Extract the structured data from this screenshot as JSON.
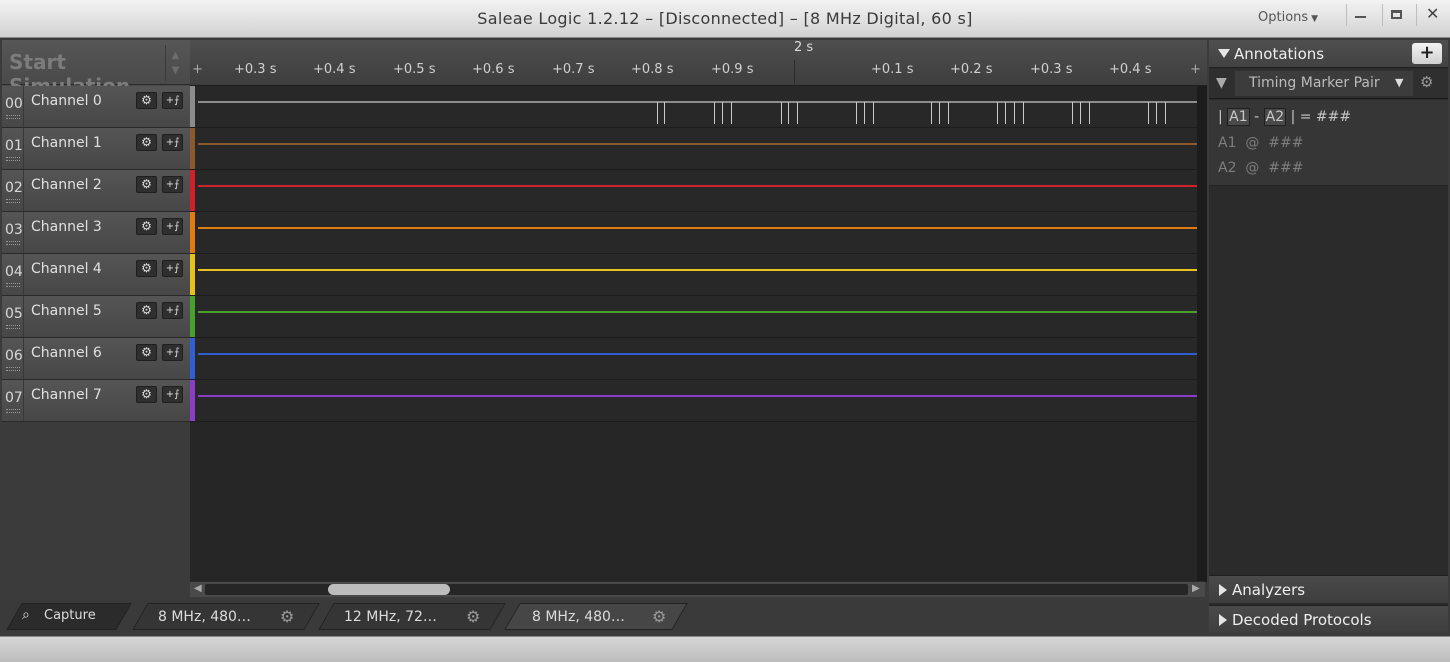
{
  "window": {
    "title": "Saleae Logic 1.2.12 – [Disconnected] – [8 MHz Digital, 60 s]",
    "options_label": "Options"
  },
  "simulation": {
    "label": "Start Simulation"
  },
  "channels": [
    {
      "num": "00",
      "name": "Channel 0",
      "color": "#8c8c8c"
    },
    {
      "num": "01",
      "name": "Channel 1",
      "color": "#8b5a2b"
    },
    {
      "num": "02",
      "name": "Channel 2",
      "color": "#d0202a"
    },
    {
      "num": "03",
      "name": "Channel 3",
      "color": "#e07b10"
    },
    {
      "num": "04",
      "name": "Channel 4",
      "color": "#e6c21a"
    },
    {
      "num": "05",
      "name": "Channel 5",
      "color": "#4aa02c"
    },
    {
      "num": "06",
      "name": "Channel 6",
      "color": "#2f5fd0"
    },
    {
      "num": "07",
      "name": "Channel 7",
      "color": "#8a3ec8"
    }
  ],
  "timeline": {
    "center_label": "2 s",
    "ticks": [
      "+0.3 s",
      "+0.4 s",
      "+0.5 s",
      "+0.6 s",
      "+0.7 s",
      "+0.8 s",
      "+0.9 s",
      "+0.1 s",
      "+0.2 s",
      "+0.3 s",
      "+0.4 s"
    ],
    "edge_left": "+",
    "edge_right": "+"
  },
  "tabs": {
    "capture_label": "Capture",
    "sessions": [
      "8 MHz, 480…",
      "12 MHz, 72…",
      "8 MHz, 480…"
    ]
  },
  "annotations": {
    "title": "Annotations",
    "add_label": "+",
    "marker_pair_label": "Timing Marker Pair",
    "a1": "A1",
    "a2": "A2",
    "diff_value": "###",
    "a1_value": "###",
    "a2_value": "###",
    "at": "@",
    "sep": "-",
    "eq": "| =",
    "bar": "|"
  },
  "panels": {
    "analyzers": "Analyzers",
    "decoded_protocols": "Decoded Protocols"
  }
}
